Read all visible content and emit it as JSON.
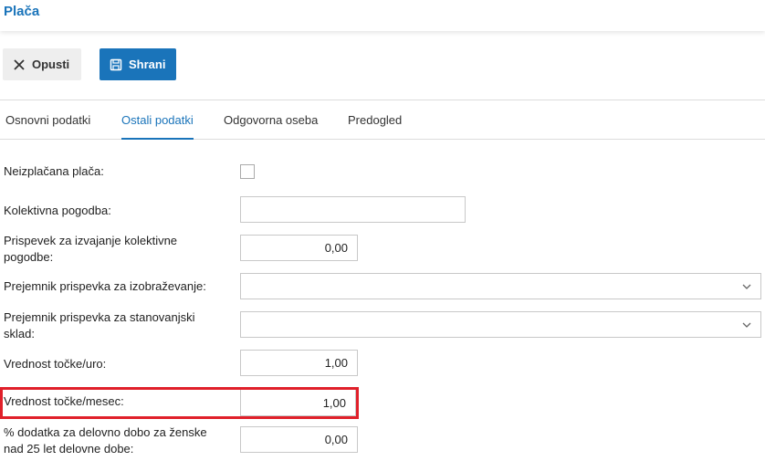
{
  "header": {
    "title": "Plača"
  },
  "toolbar": {
    "cancel_label": "Opusti",
    "save_label": "Shrani"
  },
  "tabs": [
    {
      "label": "Osnovni podatki",
      "active": false
    },
    {
      "label": "Ostali podatki",
      "active": true
    },
    {
      "label": "Odgovorna oseba",
      "active": false
    },
    {
      "label": "Predogled",
      "active": false
    }
  ],
  "form": {
    "unpaid_salary": {
      "label": "Neizplačana plača:",
      "checked": false
    },
    "collective_agreement": {
      "label": "Kolektivna pogodba:",
      "value": ""
    },
    "collective_contribution": {
      "label": "Prispevek za izvajanje kolektivne pogodbe:",
      "value": "0,00"
    },
    "education_recipient": {
      "label": "Prejemnik prispevka za izobraževanje:",
      "value": ""
    },
    "housing_recipient": {
      "label": "Prejemnik prispevka za stanovanjski sklad:",
      "value": ""
    },
    "point_value_hour": {
      "label": "Vrednost točke/uro:",
      "value": "1,00"
    },
    "point_value_month": {
      "label": "Vrednost točke/mesec:",
      "value": "1,00"
    },
    "seniority_bonus_women": {
      "label": "% dodatka za delovno dobo za ženske nad 25 let delovne dobe:",
      "value": "0,00"
    }
  },
  "colors": {
    "accent": "#1a74ba",
    "highlight": "#e0202a"
  },
  "icons": {
    "cancel": "close-icon",
    "save": "save-icon",
    "select": "chevron-down-icon"
  }
}
